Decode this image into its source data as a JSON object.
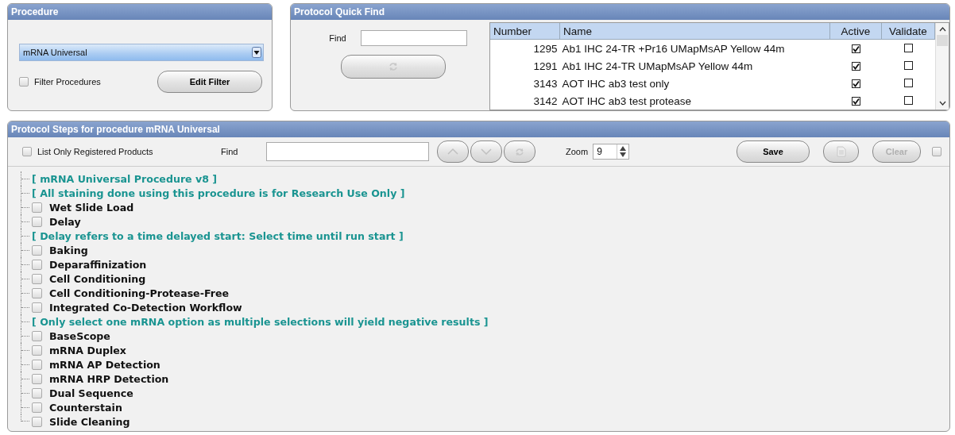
{
  "procedure_panel": {
    "title": "Procedure",
    "dropdown": {
      "value": "mRNA Universal"
    },
    "filter_checkbox": {
      "label": "Filter Procedures",
      "checked": false
    },
    "edit_filter_button": "Edit Filter"
  },
  "quick_find": {
    "title": "Protocol Quick Find",
    "find_label": "Find",
    "table": {
      "columns": [
        "Number",
        "Name",
        "Active",
        "Validate"
      ],
      "rows": [
        {
          "number": "1295",
          "name": "Ab1 IHC 24-TR +Pr16 UMapMsAP Yellow 44m",
          "active": true,
          "validate": false
        },
        {
          "number": "1291",
          "name": "Ab1 IHC 24-TR UMapMsAP Yellow 44m",
          "active": true,
          "validate": false
        },
        {
          "number": "3143",
          "name": "AOT IHC ab3 test only",
          "active": true,
          "validate": false
        },
        {
          "number": "3142",
          "name": "AOT IHC ab3 test protease",
          "active": true,
          "validate": false
        }
      ]
    }
  },
  "steps_panel": {
    "title": "Protocol Steps for procedure mRNA Universal",
    "registered_checkbox": {
      "label": "List Only Registered Products",
      "checked": false
    },
    "find_label": "Find",
    "zoom_label": "Zoom",
    "zoom_value": "9",
    "save_button": "Save",
    "clear_button": "Clear",
    "extra_checkbox": {
      "checked": false
    },
    "tree": [
      {
        "kind": "note",
        "text": "[ mRNA Universal Procedure v8 ]"
      },
      {
        "kind": "note",
        "text": "[ All staining done using this procedure is for Research Use Only ]"
      },
      {
        "kind": "step",
        "text": "Wet Slide Load",
        "checked": false
      },
      {
        "kind": "step",
        "text": "Delay",
        "checked": false
      },
      {
        "kind": "note",
        "text": "[ Delay refers to a time delayed start: Select time until run start ]"
      },
      {
        "kind": "step",
        "text": "Baking",
        "checked": false
      },
      {
        "kind": "step",
        "text": "Deparaffinization",
        "checked": false
      },
      {
        "kind": "step",
        "text": "Cell Conditioning",
        "checked": false
      },
      {
        "kind": "step",
        "text": "Cell Conditioning-Protease-Free",
        "checked": false
      },
      {
        "kind": "step",
        "text": "Integrated Co-Detection Workflow",
        "checked": false
      },
      {
        "kind": "note",
        "text": "[ Only select one mRNA option as multiple selections will yield negative results ]"
      },
      {
        "kind": "step",
        "text": "BaseScope",
        "checked": false
      },
      {
        "kind": "step",
        "text": "mRNA Duplex",
        "checked": false
      },
      {
        "kind": "step",
        "text": "mRNA AP Detection",
        "checked": false
      },
      {
        "kind": "step",
        "text": "mRNA HRP Detection",
        "checked": false
      },
      {
        "kind": "step",
        "text": "Dual Sequence",
        "checked": false
      },
      {
        "kind": "step",
        "text": "Counterstain",
        "checked": false
      },
      {
        "kind": "step",
        "text": "Slide Cleaning",
        "checked": false
      }
    ]
  }
}
